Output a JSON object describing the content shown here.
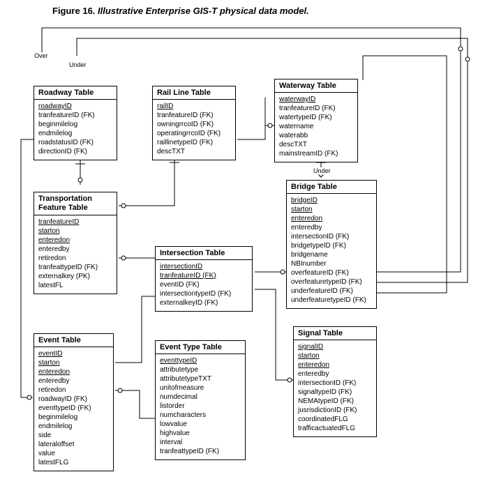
{
  "title_prefix": "Figure 16. ",
  "title_italic": "Illustrative Enterprise GIS-T physical data model.",
  "labels": {
    "over": "Over",
    "under1": "Under",
    "under2": "Under"
  },
  "roadway": {
    "name": "Roadway Table",
    "a0": "roadwayID",
    "a1": "tranfeatureID (FK)",
    "a2": "beginmilelog",
    "a3": "endmilelog",
    "a4": "roadstatusID (FK)",
    "a5": "directionID (FK)"
  },
  "rail": {
    "name": "Rail Line Table",
    "a0": "railID",
    "a1": "tranfeatureID (FK)",
    "a2": "owningrrcoID (FK)",
    "a3": "operatingrrcoID (FK)",
    "a4": "raillinetypeID (FK)",
    "a5": "descTXT"
  },
  "waterway": {
    "name": "Waterway Table",
    "a0": "waterwayID",
    "a1": "tranfeatureID (FK)",
    "a2": "watertypeID (FK)",
    "a3": "watername",
    "a4": "waterabb",
    "a5": "descTXT",
    "a6": "mainstreamID (FK)"
  },
  "feature": {
    "name": "Transportation Feature Table",
    "a0": "tranfeatureID",
    "a1": "starton",
    "a2": "enteredon",
    "a3": "enteredby",
    "a4": "retiredon",
    "a5": "tranfeattypeID (FK)",
    "a6": "externalkey (PK)",
    "a7": "latestFL"
  },
  "bridge": {
    "name": "Bridge Table",
    "a0": "bridgeID",
    "a1": "starton",
    "a2": "enteredon",
    "a3": "enteredby",
    "a4": "intersectionID (FK)",
    "a5": "bridgetypeID (FK)",
    "a6": "bridgename",
    "a7": "NBInumber",
    "a8": "overfeatureID (FK)",
    "a9": "overfeaturetypeID (FK)",
    "a10": "underfeatureID (FK)",
    "a11": "underfeaturetypeID (FK)"
  },
  "intersection": {
    "name": "Intersection Table",
    "a0": "intersectionID",
    "a1": "tranfeatureID (FK)",
    "a2": "eventID (FK)",
    "a3": "intersectiontypeID (FK)",
    "a4": "externalkeyID (FK)"
  },
  "signal": {
    "name": "Signal Table",
    "a0": "signalID",
    "a1": "starton",
    "a2": "enteredon",
    "a3": "enteredby",
    "a4": "intersectionID (FK)",
    "a5": "signaltypeID (FK)",
    "a6": "NEMAtypeID (FK)",
    "a7": "jusrisdictionID (FK)",
    "a8": "coordinatedFLG",
    "a9": "trafficactuatedFLG"
  },
  "event": {
    "name": "Event Table",
    "a0": "eventID",
    "a1": "starton",
    "a2": "enteredon",
    "a3": "enteredby",
    "a4": "retiredon",
    "a5": "roadwayID (FK)",
    "a6": "eventtypeID (FK)",
    "a7": "beginmilelog",
    "a8": "endmilelog",
    "a9": "side",
    "a10": "lateraloffset",
    "a11": "value",
    "a12": "latestFLG"
  },
  "eventtype": {
    "name": "Event Type Table",
    "a0": "eventtypeID",
    "a1": "attributetype",
    "a2": "attributetypeTXT",
    "a3": "unitofmeasure",
    "a4": "numdecimal",
    "a5": "listorder",
    "a6": "numcharacters",
    "a7": "lowvalue",
    "a8": "highvalue",
    "a9": "interval",
    "a10": "tranfeattypeID (FK)"
  }
}
